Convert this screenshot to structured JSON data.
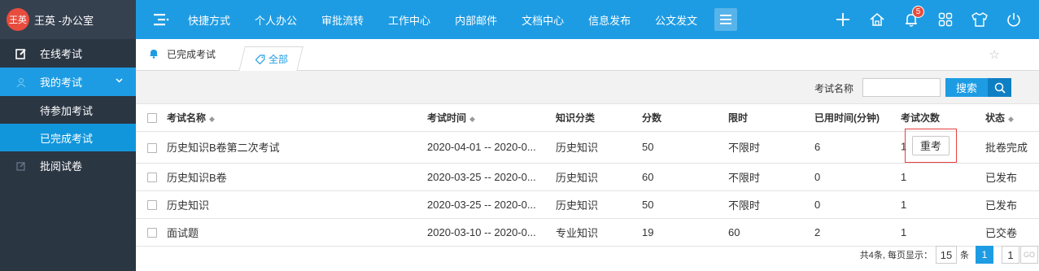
{
  "user": {
    "avatar_text": "王英",
    "name": "王英 -办公室"
  },
  "sidebar": {
    "items": [
      {
        "label": "在线考试",
        "icon": "edit-icon"
      },
      {
        "label": "我的考试",
        "icon": "person-icon"
      },
      {
        "label": "待参加考试"
      },
      {
        "label": "已完成考试"
      },
      {
        "label": "批阅试卷",
        "icon": "edit-small-icon"
      }
    ]
  },
  "topnav": {
    "items": [
      "快捷方式",
      "个人办公",
      "审批流转",
      "工作中心",
      "内部邮件",
      "文档中心",
      "信息发布",
      "公文发文"
    ],
    "notification_count": "5"
  },
  "tabs": {
    "title": "已完成考试",
    "filter_label": "全部"
  },
  "search": {
    "label": "考试名称",
    "value": "",
    "button_label": "搜索"
  },
  "table": {
    "headers": [
      "考试名称",
      "考试时间",
      "知识分类",
      "分数",
      "限时",
      "已用时间(分钟)",
      "考试次数",
      "状态"
    ],
    "rows": [
      {
        "name": "历史知识B卷第二次考试",
        "time": "2020-04-01 -- 2020-0...",
        "category": "历史知识",
        "score": "50",
        "limit": "不限时",
        "used": "6",
        "count": "1",
        "action": "重考",
        "status": "批卷完成"
      },
      {
        "name": "历史知识B卷",
        "time": "2020-03-25 -- 2020-0...",
        "category": "历史知识",
        "score": "60",
        "limit": "不限时",
        "used": "0",
        "count": "1",
        "action": "",
        "status": "已发布"
      },
      {
        "name": "历史知识",
        "time": "2020-03-25 -- 2020-0...",
        "category": "历史知识",
        "score": "50",
        "limit": "不限时",
        "used": "0",
        "count": "1",
        "action": "",
        "status": "已发布"
      },
      {
        "name": "面试题",
        "time": "2020-03-10 -- 2020-0...",
        "category": "专业知识",
        "score": "19",
        "limit": "60",
        "used": "2",
        "count": "1",
        "action": "",
        "status": "已交卷"
      }
    ]
  },
  "pager": {
    "summary": "共4条, 每页显示：",
    "page_size": "15",
    "unit": "条",
    "current": "1",
    "goto_value": "1",
    "go_label": "GO"
  },
  "colors": {
    "primary": "#1e9ce3",
    "sidebar_bg": "#2b3643",
    "badge": "#e74c3c",
    "highlight_border": "#e84040"
  }
}
